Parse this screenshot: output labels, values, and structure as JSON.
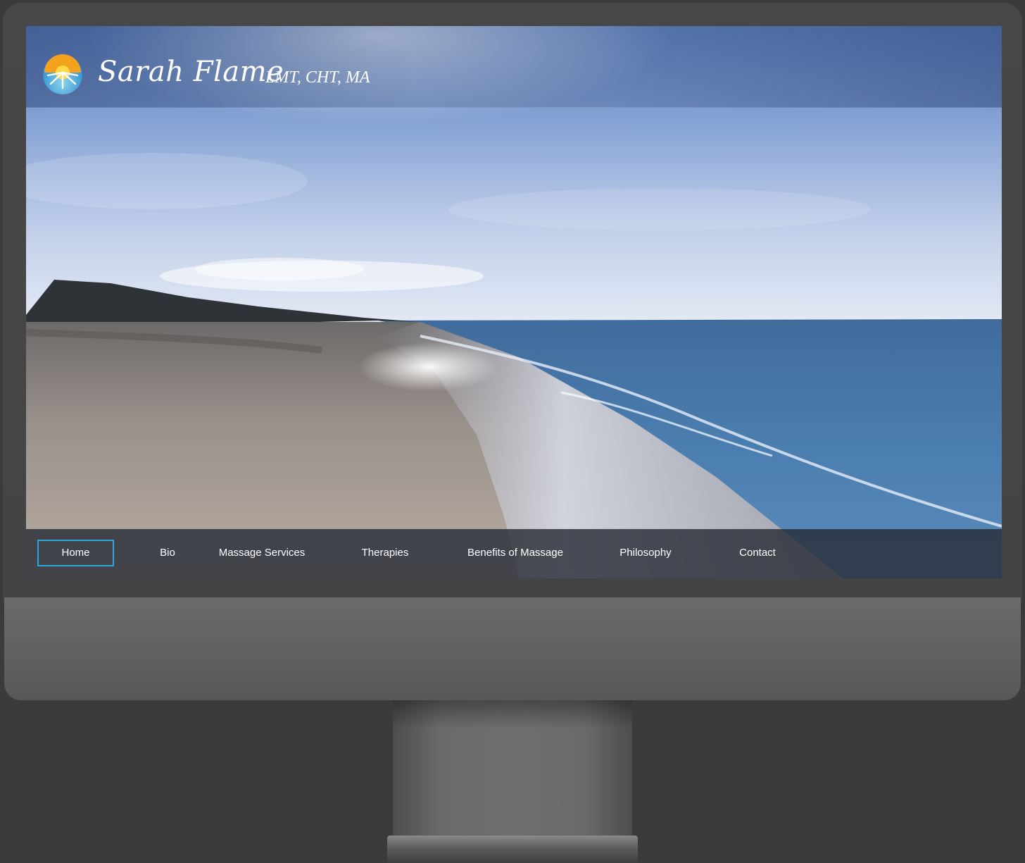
{
  "site": {
    "name": "Sarah Flame",
    "credentials": "LMT, CHT, MA"
  },
  "nav": {
    "items": [
      {
        "label": "Home",
        "active": true
      },
      {
        "label": "Bio",
        "active": false
      },
      {
        "label": "Massage Services",
        "active": false
      },
      {
        "label": "Therapies",
        "active": false
      },
      {
        "label": "Benefits of Massage",
        "active": false
      },
      {
        "label": "Philosophy",
        "active": false
      },
      {
        "label": "Contact",
        "active": false
      }
    ]
  },
  "colors": {
    "active_nav_border": "#2ba8d6",
    "nav_background": "#282d37",
    "monitor_frame": "#474747"
  },
  "hero": {
    "image": "beach-shoreline-photo"
  },
  "logo": {
    "icon": "sun-logo-icon"
  }
}
